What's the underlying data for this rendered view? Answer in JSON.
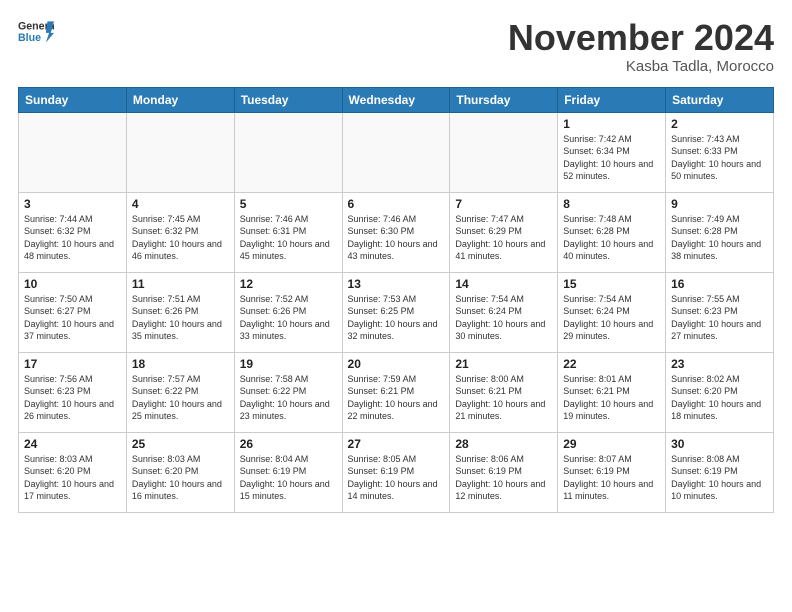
{
  "header": {
    "logo_line1": "General",
    "logo_line2": "Blue",
    "month_title": "November 2024",
    "location": "Kasba Tadla, Morocco"
  },
  "weekdays": [
    "Sunday",
    "Monday",
    "Tuesday",
    "Wednesday",
    "Thursday",
    "Friday",
    "Saturday"
  ],
  "weeks": [
    [
      {
        "day": "",
        "info": ""
      },
      {
        "day": "",
        "info": ""
      },
      {
        "day": "",
        "info": ""
      },
      {
        "day": "",
        "info": ""
      },
      {
        "day": "",
        "info": ""
      },
      {
        "day": "1",
        "info": "Sunrise: 7:42 AM\nSunset: 6:34 PM\nDaylight: 10 hours and 52 minutes."
      },
      {
        "day": "2",
        "info": "Sunrise: 7:43 AM\nSunset: 6:33 PM\nDaylight: 10 hours and 50 minutes."
      }
    ],
    [
      {
        "day": "3",
        "info": "Sunrise: 7:44 AM\nSunset: 6:32 PM\nDaylight: 10 hours and 48 minutes."
      },
      {
        "day": "4",
        "info": "Sunrise: 7:45 AM\nSunset: 6:32 PM\nDaylight: 10 hours and 46 minutes."
      },
      {
        "day": "5",
        "info": "Sunrise: 7:46 AM\nSunset: 6:31 PM\nDaylight: 10 hours and 45 minutes."
      },
      {
        "day": "6",
        "info": "Sunrise: 7:46 AM\nSunset: 6:30 PM\nDaylight: 10 hours and 43 minutes."
      },
      {
        "day": "7",
        "info": "Sunrise: 7:47 AM\nSunset: 6:29 PM\nDaylight: 10 hours and 41 minutes."
      },
      {
        "day": "8",
        "info": "Sunrise: 7:48 AM\nSunset: 6:28 PM\nDaylight: 10 hours and 40 minutes."
      },
      {
        "day": "9",
        "info": "Sunrise: 7:49 AM\nSunset: 6:28 PM\nDaylight: 10 hours and 38 minutes."
      }
    ],
    [
      {
        "day": "10",
        "info": "Sunrise: 7:50 AM\nSunset: 6:27 PM\nDaylight: 10 hours and 37 minutes."
      },
      {
        "day": "11",
        "info": "Sunrise: 7:51 AM\nSunset: 6:26 PM\nDaylight: 10 hours and 35 minutes."
      },
      {
        "day": "12",
        "info": "Sunrise: 7:52 AM\nSunset: 6:26 PM\nDaylight: 10 hours and 33 minutes."
      },
      {
        "day": "13",
        "info": "Sunrise: 7:53 AM\nSunset: 6:25 PM\nDaylight: 10 hours and 32 minutes."
      },
      {
        "day": "14",
        "info": "Sunrise: 7:54 AM\nSunset: 6:24 PM\nDaylight: 10 hours and 30 minutes."
      },
      {
        "day": "15",
        "info": "Sunrise: 7:54 AM\nSunset: 6:24 PM\nDaylight: 10 hours and 29 minutes."
      },
      {
        "day": "16",
        "info": "Sunrise: 7:55 AM\nSunset: 6:23 PM\nDaylight: 10 hours and 27 minutes."
      }
    ],
    [
      {
        "day": "17",
        "info": "Sunrise: 7:56 AM\nSunset: 6:23 PM\nDaylight: 10 hours and 26 minutes."
      },
      {
        "day": "18",
        "info": "Sunrise: 7:57 AM\nSunset: 6:22 PM\nDaylight: 10 hours and 25 minutes."
      },
      {
        "day": "19",
        "info": "Sunrise: 7:58 AM\nSunset: 6:22 PM\nDaylight: 10 hours and 23 minutes."
      },
      {
        "day": "20",
        "info": "Sunrise: 7:59 AM\nSunset: 6:21 PM\nDaylight: 10 hours and 22 minutes."
      },
      {
        "day": "21",
        "info": "Sunrise: 8:00 AM\nSunset: 6:21 PM\nDaylight: 10 hours and 21 minutes."
      },
      {
        "day": "22",
        "info": "Sunrise: 8:01 AM\nSunset: 6:21 PM\nDaylight: 10 hours and 19 minutes."
      },
      {
        "day": "23",
        "info": "Sunrise: 8:02 AM\nSunset: 6:20 PM\nDaylight: 10 hours and 18 minutes."
      }
    ],
    [
      {
        "day": "24",
        "info": "Sunrise: 8:03 AM\nSunset: 6:20 PM\nDaylight: 10 hours and 17 minutes."
      },
      {
        "day": "25",
        "info": "Sunrise: 8:03 AM\nSunset: 6:20 PM\nDaylight: 10 hours and 16 minutes."
      },
      {
        "day": "26",
        "info": "Sunrise: 8:04 AM\nSunset: 6:19 PM\nDaylight: 10 hours and 15 minutes."
      },
      {
        "day": "27",
        "info": "Sunrise: 8:05 AM\nSunset: 6:19 PM\nDaylight: 10 hours and 14 minutes."
      },
      {
        "day": "28",
        "info": "Sunrise: 8:06 AM\nSunset: 6:19 PM\nDaylight: 10 hours and 12 minutes."
      },
      {
        "day": "29",
        "info": "Sunrise: 8:07 AM\nSunset: 6:19 PM\nDaylight: 10 hours and 11 minutes."
      },
      {
        "day": "30",
        "info": "Sunrise: 8:08 AM\nSunset: 6:19 PM\nDaylight: 10 hours and 10 minutes."
      }
    ]
  ]
}
